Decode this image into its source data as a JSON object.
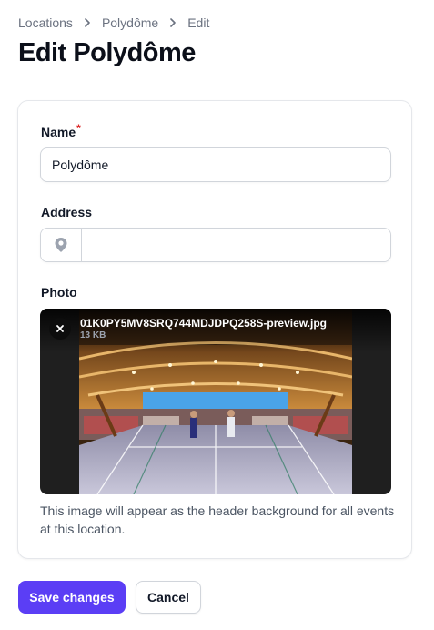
{
  "breadcrumb": {
    "items": [
      "Locations",
      "Polydôme",
      "Edit"
    ]
  },
  "page": {
    "title": "Edit Polydôme"
  },
  "form": {
    "name": {
      "label": "Name",
      "required_mark": "*",
      "value": "Polydôme"
    },
    "address": {
      "label": "Address",
      "value": "",
      "icon": "map-pin-icon"
    },
    "photo": {
      "label": "Photo",
      "file_name": "01K0PY5MV8SRQ744MDJDPQ258S-preview.jpg",
      "file_size": "13 KB",
      "remove_icon": "close-icon",
      "help_text": "This image will appear as the header background for all events at this location."
    }
  },
  "actions": {
    "save_label": "Save changes",
    "cancel_label": "Cancel"
  },
  "colors": {
    "primary": "#5b3ef5",
    "required": "#dc2626",
    "muted": "#6b7280"
  }
}
